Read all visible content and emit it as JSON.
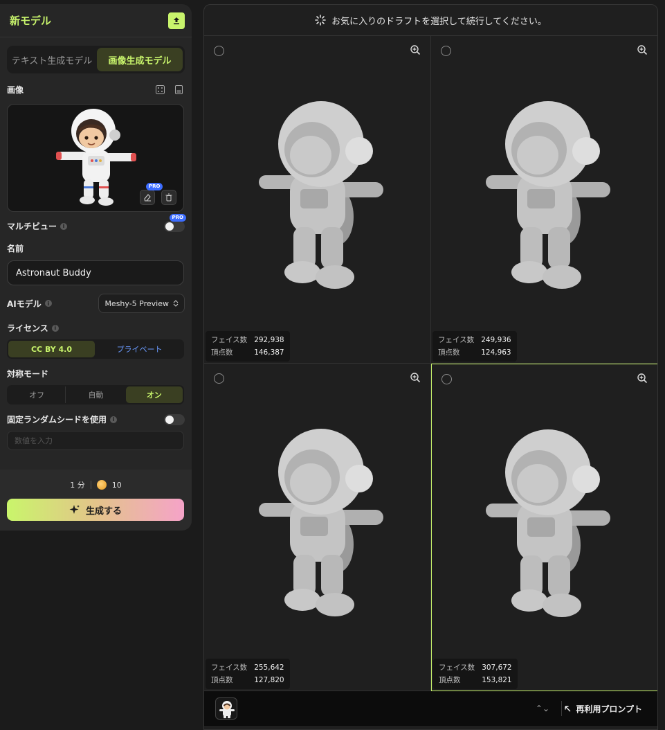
{
  "sidebar": {
    "title": "新モデル",
    "tabs": [
      {
        "label": "テキスト生成モデル",
        "active": false
      },
      {
        "label": "画像生成モデル",
        "active": true
      }
    ],
    "image_section": {
      "label": "画像",
      "pro_badge": "PRO"
    },
    "multiview": {
      "label": "マルチビュー",
      "pro_badge": "PRO",
      "enabled": false
    },
    "name": {
      "label": "名前",
      "value": "Astronaut Buddy"
    },
    "ai_model": {
      "label": "AIモデル",
      "value": "Meshy-5 Preview"
    },
    "license": {
      "label": "ライセンス",
      "options": [
        {
          "label": "CC BY 4.0",
          "active": true
        },
        {
          "label": "プライベート",
          "active": false
        }
      ]
    },
    "symmetry": {
      "label": "対称モード",
      "options": [
        {
          "label": "オフ",
          "active": false
        },
        {
          "label": "自動",
          "active": false
        },
        {
          "label": "オン",
          "active": true
        }
      ]
    },
    "seed": {
      "label": "固定ランダムシードを使用",
      "enabled": false,
      "placeholder": "数値を入力"
    },
    "footer": {
      "time": "1 分",
      "credits": "10",
      "generate_label": "生成する"
    }
  },
  "main": {
    "header": "お気に入りのドラフトを選択して続行してください。",
    "drafts": [
      {
        "faces_label": "フェイス数",
        "faces": "292,938",
        "vertices_label": "頂点数",
        "vertices": "146,387",
        "selected": false
      },
      {
        "faces_label": "フェイス数",
        "faces": "249,936",
        "vertices_label": "頂点数",
        "vertices": "124,963",
        "selected": false
      },
      {
        "faces_label": "フェイス数",
        "faces": "255,642",
        "vertices_label": "頂点数",
        "vertices": "127,820",
        "selected": false
      },
      {
        "faces_label": "フェイス数",
        "faces": "307,672",
        "vertices_label": "頂点数",
        "vertices": "153,821",
        "selected": true
      }
    ],
    "bottom": {
      "reuse_label": "再利用プロンプト"
    }
  },
  "colors": {
    "accent": "#c8f46c",
    "link": "#6b9bff",
    "pro": "#3d6dff"
  }
}
